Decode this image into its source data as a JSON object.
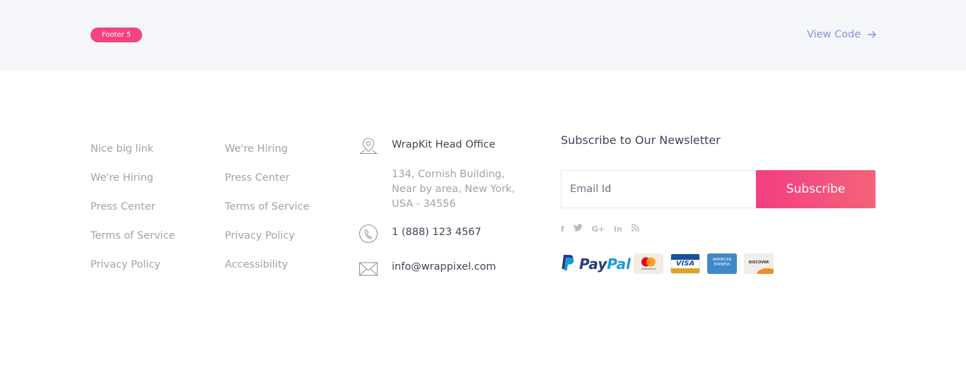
{
  "header": {
    "badge": "Footer 5",
    "view_code": "View Code"
  },
  "links_col1": [
    "Nice big link",
    "We're Hiring",
    "Press Center",
    "Terms of Service",
    "Privacy Policy"
  ],
  "links_col2": [
    "We're Hiring",
    "Press Center",
    "Terms of Service",
    "Privacy Policy",
    "Accessibility"
  ],
  "contact": {
    "office_title": "WrapKit Head Office",
    "address": [
      "134, Cornish Building,",
      "Near by area, New York,",
      "USA - 34556"
    ],
    "phone": "1 (888) 123 4567",
    "email": "info@wrappixel.com",
    "icons": [
      "map-pin-icon",
      "phone-icon",
      "envelope-icon"
    ]
  },
  "newsletter": {
    "title": "Subscribe to Our Newsletter",
    "email_placeholder": "Email Id",
    "subscribe_label": "Subscribe"
  },
  "social": [
    "f",
    "t",
    "G+",
    "in",
    "rss"
  ],
  "social_icons": [
    "facebook-icon",
    "twitter-icon",
    "google-plus-icon",
    "linkedin-icon",
    "rss-icon"
  ],
  "payments": {
    "paypal_text": "PayPal",
    "mastercard_text": "mastercard",
    "visa_text": "VISA",
    "amex_text": [
      "AMERICAN",
      "EXPRESS"
    ],
    "discover_text": "DISCOVER"
  },
  "colors": {
    "accent_pink": "#f3447d",
    "link_blue": "#8a90e0",
    "muted_text": "#9ea3ac",
    "dark_text": "#3e4555",
    "paypal_dark": "#253b80",
    "paypal_light": "#179bd7"
  }
}
